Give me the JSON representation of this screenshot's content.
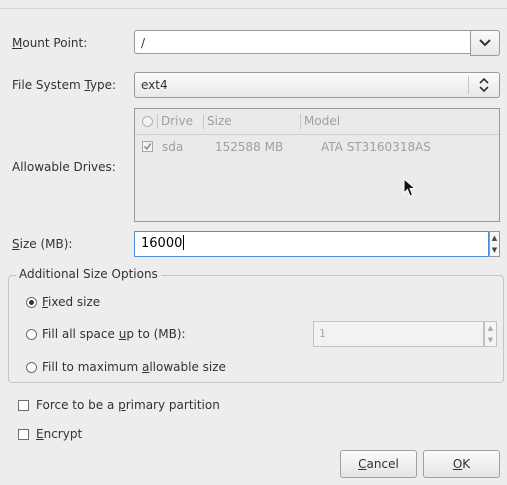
{
  "mount_point": {
    "label_mnemonic": "M",
    "label_rest": "ount Point:",
    "value": "/",
    "dropdown_icon": "chevron-down-icon"
  },
  "fs_type": {
    "label_pre": "File System ",
    "label_mnemonic": "T",
    "label_post": "ype:",
    "value": "ext4",
    "icon": "up-down-arrows-icon"
  },
  "drives": {
    "label": "Allowable Drives:",
    "columns": [
      "Drive",
      "Size",
      "Model"
    ],
    "rows": [
      {
        "checked": true,
        "drive": "sda",
        "size": "152588 MB",
        "model": "ATA ST3160318AS"
      }
    ]
  },
  "size": {
    "label_mnemonic": "S",
    "label_rest": "ize (MB):",
    "value": "16000"
  },
  "additional": {
    "title": "Additional Size Options",
    "fixed": {
      "mnemonic": "F",
      "rest": "ixed size",
      "selected": true
    },
    "fill_upto": {
      "pre": "Fill all space ",
      "mnemonic": "u",
      "post": "p to (MB):",
      "selected": false,
      "value": "1"
    },
    "fill_max": {
      "pre": "Fill to maximum ",
      "mnemonic": "a",
      "post": "llowable size",
      "selected": false
    }
  },
  "primary": {
    "pre": "Force to be a ",
    "mnemonic": "p",
    "post": "rimary partition",
    "checked": false
  },
  "encrypt": {
    "mnemonic": "E",
    "rest": "ncrypt",
    "checked": false
  },
  "buttons": {
    "cancel": {
      "mnemonic": "C",
      "rest": "ancel"
    },
    "ok": {
      "mnemonic": "O",
      "rest": "K"
    }
  },
  "colors": {
    "focus": "#4a90d9",
    "background": "#ededed"
  }
}
